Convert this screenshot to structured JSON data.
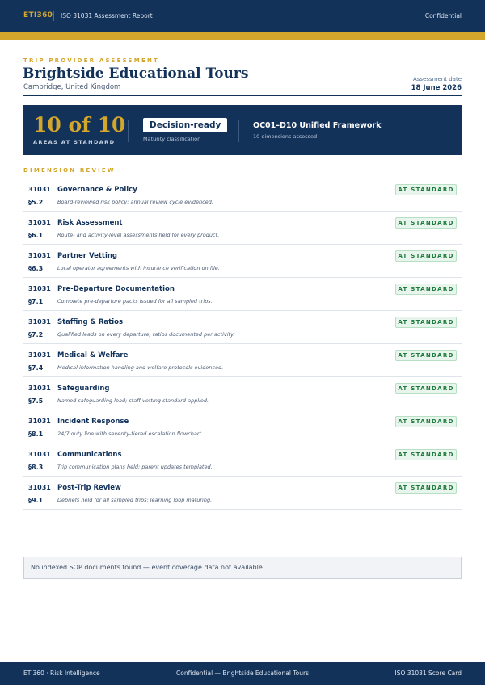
{
  "header": {
    "brand": "ETI360",
    "report_title": "ISO 31031 Assessment Report",
    "classification": "Confidential"
  },
  "title_block": {
    "eyebrow": "TRIP PROVIDER ASSESSMENT",
    "provider_name": "Brightside Educational Tours",
    "location": "Cambridge, United Kingdom",
    "date_label": "Assessment date",
    "date_value": "18 June 2026"
  },
  "summary": {
    "score": "10 of 10",
    "score_label": "AREAS AT STANDARD",
    "maturity": "Decision-ready",
    "maturity_label": "Maturity classification",
    "framework": "OC01–D10 Unified Framework",
    "framework_sub": "10 dimensions assessed"
  },
  "section_title": "DIMENSION REVIEW",
  "dimensions": [
    {
      "standard": "31031",
      "clause": "§5.2",
      "name": "Governance & Policy",
      "description": "Board-reviewed risk policy; annual review cycle evidenced.",
      "status": "AT STANDARD"
    },
    {
      "standard": "31031",
      "clause": "§6.1",
      "name": "Risk Assessment",
      "description": "Route- and activity-level assessments held for every product.",
      "status": "AT STANDARD"
    },
    {
      "standard": "31031",
      "clause": "§6.3",
      "name": "Partner Vetting",
      "description": "Local operator agreements with insurance verification on file.",
      "status": "AT STANDARD"
    },
    {
      "standard": "31031",
      "clause": "§7.1",
      "name": "Pre-Departure Documentation",
      "description": "Complete pre-departure packs issued for all sampled trips.",
      "status": "AT STANDARD"
    },
    {
      "standard": "31031",
      "clause": "§7.2",
      "name": "Staffing & Ratios",
      "description": "Qualified leads on every departure; ratios documented per activity.",
      "status": "AT STANDARD"
    },
    {
      "standard": "31031",
      "clause": "§7.4",
      "name": "Medical & Welfare",
      "description": "Medical information handling and welfare protocols evidenced.",
      "status": "AT STANDARD"
    },
    {
      "standard": "31031",
      "clause": "§7.5",
      "name": "Safeguarding",
      "description": "Named safeguarding lead; staff vetting standard applied.",
      "status": "AT STANDARD"
    },
    {
      "standard": "31031",
      "clause": "§8.1",
      "name": "Incident Response",
      "description": "24/7 duty line with severity-tiered escalation flowchart.",
      "status": "AT STANDARD"
    },
    {
      "standard": "31031",
      "clause": "§8.3",
      "name": "Communications",
      "description": "Trip communication plans held; parent updates templated.",
      "status": "AT STANDARD"
    },
    {
      "standard": "31031",
      "clause": "§9.1",
      "name": "Post-Trip Review",
      "description": "Debriefs held for all sampled trips; learning loop maturing.",
      "status": "AT STANDARD"
    }
  ],
  "notice": "No indexed SOP documents found — event coverage data not available.",
  "footer": {
    "left": "ETI360 · Risk Intelligence",
    "center": "Confidential — Brightside Educational Tours",
    "right": "ISO 31031 Score Card"
  },
  "colors": {
    "navy": "#12325a",
    "gold": "#d4a72c",
    "status_green": "#1e7a3c"
  }
}
